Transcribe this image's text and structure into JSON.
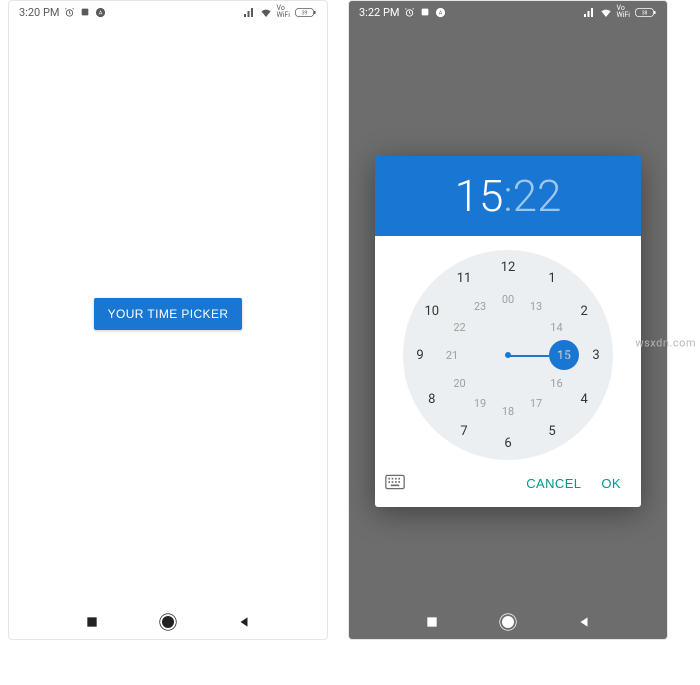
{
  "left": {
    "status": {
      "time": "3:20 PM",
      "icons": [
        "alarm-icon",
        "square-icon",
        "circle-a-icon"
      ],
      "right_icons": [
        "signal-icon",
        "wifi-icon",
        "vowifi-icon",
        "battery-icon"
      ],
      "battery_text": "39"
    },
    "button_label": "YOUR TIME PICKER"
  },
  "right": {
    "status": {
      "time": "3:22 PM",
      "icons": [
        "alarm-icon",
        "square-icon",
        "circle-a-icon"
      ],
      "right_icons": [
        "signal-icon",
        "wifi-icon",
        "vowifi-icon",
        "battery-icon"
      ],
      "battery_text": "38"
    },
    "time_hour": "15",
    "time_minute": "22",
    "outer_hours": [
      "12",
      "1",
      "2",
      "3",
      "4",
      "5",
      "6",
      "7",
      "8",
      "9",
      "10",
      "11"
    ],
    "inner_hours": [
      "00",
      "13",
      "14",
      "15",
      "16",
      "17",
      "18",
      "19",
      "20",
      "21",
      "22",
      "23"
    ],
    "selected_inner_index": 3,
    "actions": {
      "cancel": "CANCEL",
      "ok": "OK"
    }
  },
  "watermark": "wsxdn.com",
  "colors": {
    "accent": "#1976d2",
    "action": "#009688"
  }
}
